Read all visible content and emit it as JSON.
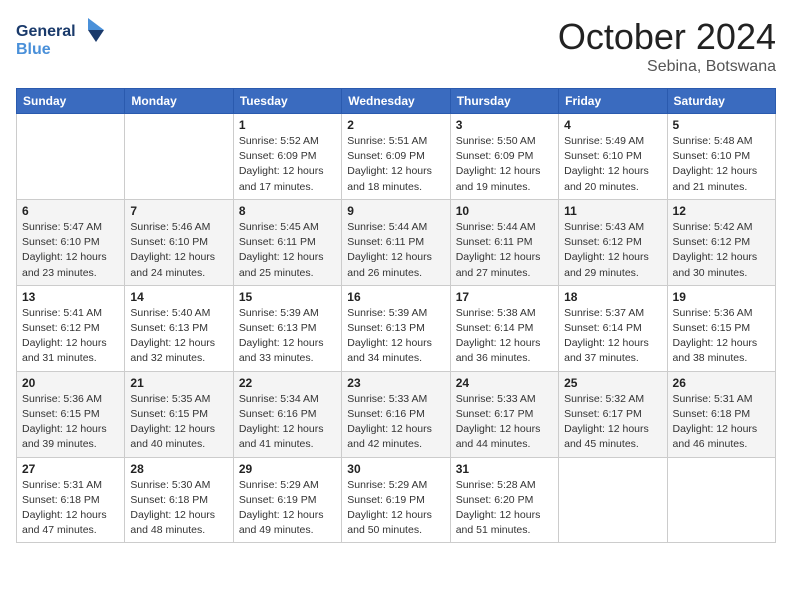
{
  "header": {
    "logo": {
      "line1": "General",
      "line2": "Blue"
    },
    "title": "October 2024",
    "location": "Sebina, Botswana"
  },
  "weekdays": [
    "Sunday",
    "Monday",
    "Tuesday",
    "Wednesday",
    "Thursday",
    "Friday",
    "Saturday"
  ],
  "weeks": [
    [
      {
        "day": "",
        "info": ""
      },
      {
        "day": "",
        "info": ""
      },
      {
        "day": "1",
        "info": "Sunrise: 5:52 AM\nSunset: 6:09 PM\nDaylight: 12 hours and 17 minutes."
      },
      {
        "day": "2",
        "info": "Sunrise: 5:51 AM\nSunset: 6:09 PM\nDaylight: 12 hours and 18 minutes."
      },
      {
        "day": "3",
        "info": "Sunrise: 5:50 AM\nSunset: 6:09 PM\nDaylight: 12 hours and 19 minutes."
      },
      {
        "day": "4",
        "info": "Sunrise: 5:49 AM\nSunset: 6:10 PM\nDaylight: 12 hours and 20 minutes."
      },
      {
        "day": "5",
        "info": "Sunrise: 5:48 AM\nSunset: 6:10 PM\nDaylight: 12 hours and 21 minutes."
      }
    ],
    [
      {
        "day": "6",
        "info": "Sunrise: 5:47 AM\nSunset: 6:10 PM\nDaylight: 12 hours and 23 minutes."
      },
      {
        "day": "7",
        "info": "Sunrise: 5:46 AM\nSunset: 6:10 PM\nDaylight: 12 hours and 24 minutes."
      },
      {
        "day": "8",
        "info": "Sunrise: 5:45 AM\nSunset: 6:11 PM\nDaylight: 12 hours and 25 minutes."
      },
      {
        "day": "9",
        "info": "Sunrise: 5:44 AM\nSunset: 6:11 PM\nDaylight: 12 hours and 26 minutes."
      },
      {
        "day": "10",
        "info": "Sunrise: 5:44 AM\nSunset: 6:11 PM\nDaylight: 12 hours and 27 minutes."
      },
      {
        "day": "11",
        "info": "Sunrise: 5:43 AM\nSunset: 6:12 PM\nDaylight: 12 hours and 29 minutes."
      },
      {
        "day": "12",
        "info": "Sunrise: 5:42 AM\nSunset: 6:12 PM\nDaylight: 12 hours and 30 minutes."
      }
    ],
    [
      {
        "day": "13",
        "info": "Sunrise: 5:41 AM\nSunset: 6:12 PM\nDaylight: 12 hours and 31 minutes."
      },
      {
        "day": "14",
        "info": "Sunrise: 5:40 AM\nSunset: 6:13 PM\nDaylight: 12 hours and 32 minutes."
      },
      {
        "day": "15",
        "info": "Sunrise: 5:39 AM\nSunset: 6:13 PM\nDaylight: 12 hours and 33 minutes."
      },
      {
        "day": "16",
        "info": "Sunrise: 5:39 AM\nSunset: 6:13 PM\nDaylight: 12 hours and 34 minutes."
      },
      {
        "day": "17",
        "info": "Sunrise: 5:38 AM\nSunset: 6:14 PM\nDaylight: 12 hours and 36 minutes."
      },
      {
        "day": "18",
        "info": "Sunrise: 5:37 AM\nSunset: 6:14 PM\nDaylight: 12 hours and 37 minutes."
      },
      {
        "day": "19",
        "info": "Sunrise: 5:36 AM\nSunset: 6:15 PM\nDaylight: 12 hours and 38 minutes."
      }
    ],
    [
      {
        "day": "20",
        "info": "Sunrise: 5:36 AM\nSunset: 6:15 PM\nDaylight: 12 hours and 39 minutes."
      },
      {
        "day": "21",
        "info": "Sunrise: 5:35 AM\nSunset: 6:15 PM\nDaylight: 12 hours and 40 minutes."
      },
      {
        "day": "22",
        "info": "Sunrise: 5:34 AM\nSunset: 6:16 PM\nDaylight: 12 hours and 41 minutes."
      },
      {
        "day": "23",
        "info": "Sunrise: 5:33 AM\nSunset: 6:16 PM\nDaylight: 12 hours and 42 minutes."
      },
      {
        "day": "24",
        "info": "Sunrise: 5:33 AM\nSunset: 6:17 PM\nDaylight: 12 hours and 44 minutes."
      },
      {
        "day": "25",
        "info": "Sunrise: 5:32 AM\nSunset: 6:17 PM\nDaylight: 12 hours and 45 minutes."
      },
      {
        "day": "26",
        "info": "Sunrise: 5:31 AM\nSunset: 6:18 PM\nDaylight: 12 hours and 46 minutes."
      }
    ],
    [
      {
        "day": "27",
        "info": "Sunrise: 5:31 AM\nSunset: 6:18 PM\nDaylight: 12 hours and 47 minutes."
      },
      {
        "day": "28",
        "info": "Sunrise: 5:30 AM\nSunset: 6:18 PM\nDaylight: 12 hours and 48 minutes."
      },
      {
        "day": "29",
        "info": "Sunrise: 5:29 AM\nSunset: 6:19 PM\nDaylight: 12 hours and 49 minutes."
      },
      {
        "day": "30",
        "info": "Sunrise: 5:29 AM\nSunset: 6:19 PM\nDaylight: 12 hours and 50 minutes."
      },
      {
        "day": "31",
        "info": "Sunrise: 5:28 AM\nSunset: 6:20 PM\nDaylight: 12 hours and 51 minutes."
      },
      {
        "day": "",
        "info": ""
      },
      {
        "day": "",
        "info": ""
      }
    ]
  ]
}
